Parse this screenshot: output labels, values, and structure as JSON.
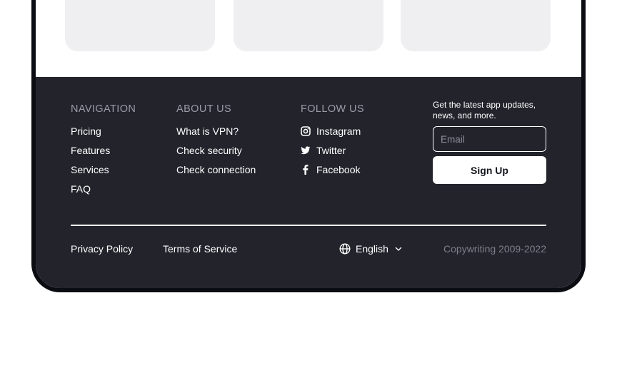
{
  "footer": {
    "navigation": {
      "title": "NAVIGATION",
      "links": [
        "Pricing",
        "Features",
        "Services",
        "FAQ"
      ]
    },
    "about": {
      "title": "ABOUT US",
      "links": [
        "What is VPN?",
        "Check security",
        "Check connection"
      ]
    },
    "follow": {
      "title": "FOLLOW US",
      "links": [
        {
          "label": "Instagram",
          "icon": "instagram-icon"
        },
        {
          "label": "Twitter",
          "icon": "twitter-icon"
        },
        {
          "label": "Facebook",
          "icon": "facebook-icon"
        }
      ]
    },
    "newsletter": {
      "text": "Get the latest app updates, news, and more.",
      "email_placeholder": "Email",
      "email_value": "",
      "signup_label": "Sign Up"
    },
    "bottom": {
      "privacy": "Privacy Policy",
      "terms": "Terms of Service",
      "language": "English",
      "language_icon": "globe-icon",
      "copyright": "Copywriting 2009-2022"
    }
  },
  "colors": {
    "footer_bg": "#22232b",
    "card_bg": "#efeff1",
    "muted_text": "#9a9ba4"
  }
}
